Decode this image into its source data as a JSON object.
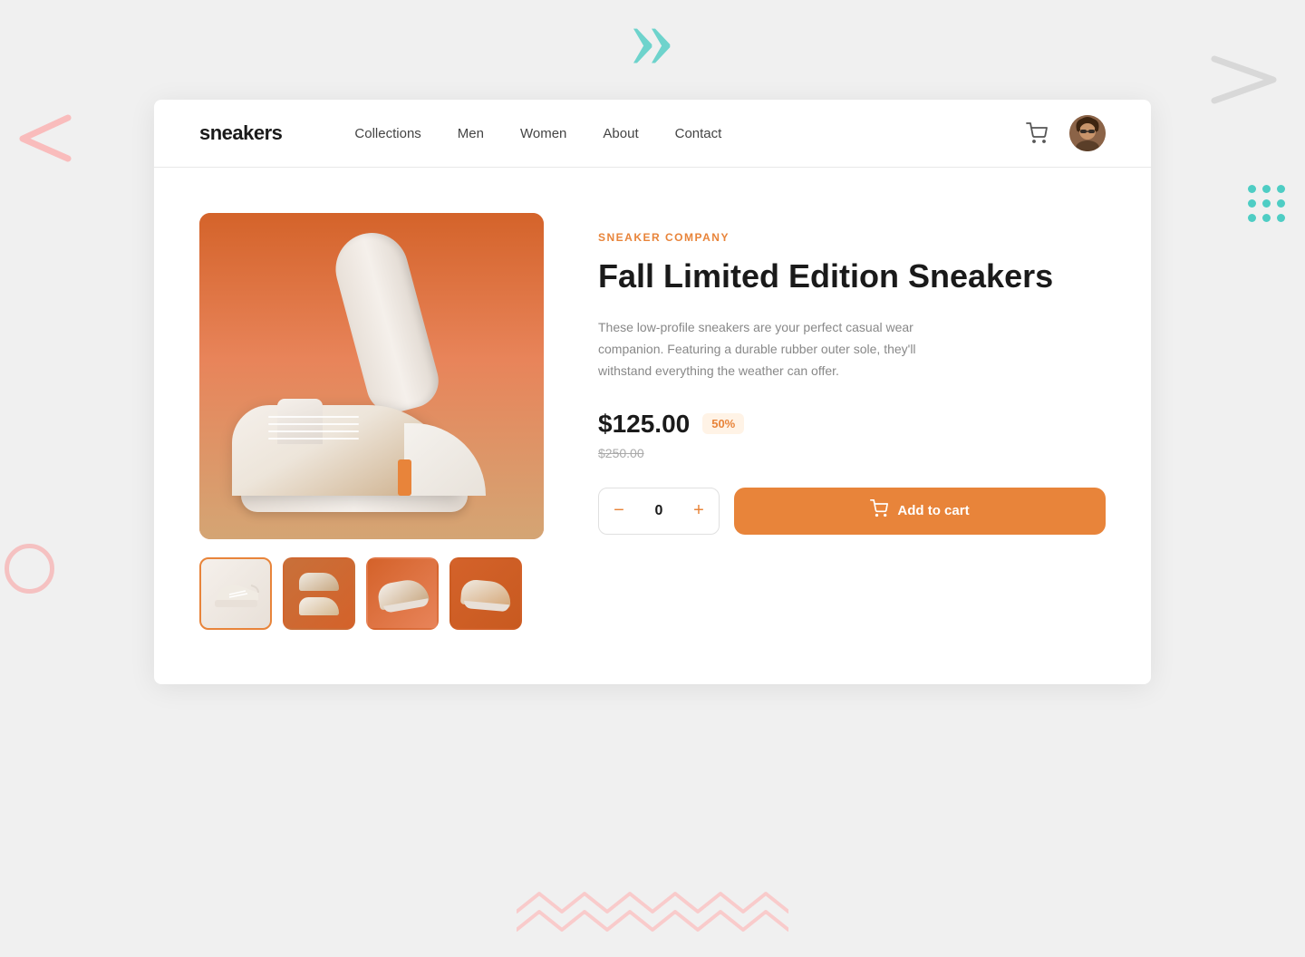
{
  "background": {
    "quotemark": "»",
    "colors": {
      "teal": "#4ecdc4",
      "pink": "#ff6b6b",
      "orange": "#E8843A"
    }
  },
  "nav": {
    "logo": "sneakers",
    "links": [
      {
        "label": "Collections",
        "id": "collections"
      },
      {
        "label": "Men",
        "id": "men"
      },
      {
        "label": "Women",
        "id": "women"
      },
      {
        "label": "About",
        "id": "about"
      },
      {
        "label": "Contact",
        "id": "contact"
      }
    ],
    "cart_aria": "Shopping cart",
    "avatar_aria": "User profile"
  },
  "product": {
    "brand": "SNEAKER COMPANY",
    "title": "Fall Limited Edition Sneakers",
    "description": "These low-profile sneakers are your perfect casual wear companion. Featuring a durable rubber outer sole, they'll withstand everything the weather can offer.",
    "price_current": "$125.00",
    "discount_badge": "50%",
    "price_original": "$250.00",
    "quantity": 0,
    "add_to_cart_label": "Add to cart",
    "qty_minus_label": "−",
    "qty_plus_label": "+"
  },
  "thumbnails": [
    {
      "id": "thumb-1",
      "active": true
    },
    {
      "id": "thumb-2",
      "active": false
    },
    {
      "id": "thumb-3",
      "active": false
    },
    {
      "id": "thumb-4",
      "active": false
    }
  ]
}
